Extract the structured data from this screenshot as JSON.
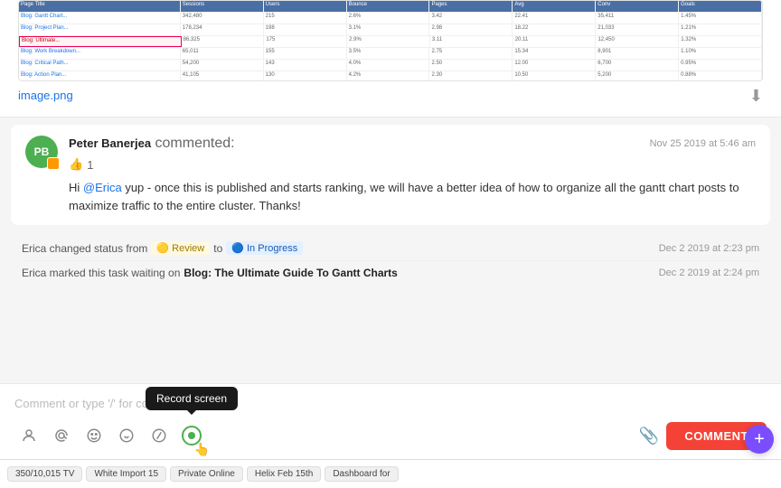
{
  "image": {
    "filename": "image.png",
    "download_label": "⬇"
  },
  "comment": {
    "author": "Peter Banerjea",
    "action_text": "commented:",
    "timestamp": "Nov 25 2019 at 5:46 am",
    "avatar_initials": "PB",
    "like_count": "1",
    "text_start": "Hi ",
    "mention": "@Erica",
    "text_end": " yup - once this is published and starts ranking, we will have a better idea of how to organize all the gantt chart posts to maximize traffic to the entire cluster. Thanks!"
  },
  "status_changes": [
    {
      "text_before": "Erica changed status from",
      "from_badge": "🟡 Review",
      "to_word": "to",
      "to_badge": "🔵 In Progress",
      "timestamp": "Dec 2 2019 at 2:23 pm"
    },
    {
      "text_before": "Erica marked this task waiting on",
      "task_link": "Blog: The Ultimate Guide To Gantt Charts",
      "timestamp": "Dec 2 2019 at 2:24 pm"
    }
  ],
  "input": {
    "placeholder": "Comment or type '/' for commands"
  },
  "toolbar": {
    "icons": [
      {
        "name": "person-icon",
        "symbol": "☺",
        "label": "Assign"
      },
      {
        "name": "mention-icon",
        "symbol": "@",
        "label": "Mention"
      },
      {
        "name": "emoji-icon",
        "symbol": "😊",
        "label": "Emoji"
      },
      {
        "name": "happy-face-icon",
        "symbol": "🙂",
        "label": "Happy"
      },
      {
        "name": "slash-icon",
        "symbol": "/",
        "label": "Commands"
      },
      {
        "name": "record-screen-icon",
        "symbol": "●",
        "label": "Record screen"
      }
    ],
    "comment_button": "COMMENT",
    "tooltip_record": "Record screen"
  },
  "taskbar": {
    "items": [
      "350/10,015 TV",
      "White Import 15",
      "Private Online",
      "Helix Feb 15th",
      "Dashboard for"
    ]
  },
  "fab": {
    "label": "+"
  }
}
